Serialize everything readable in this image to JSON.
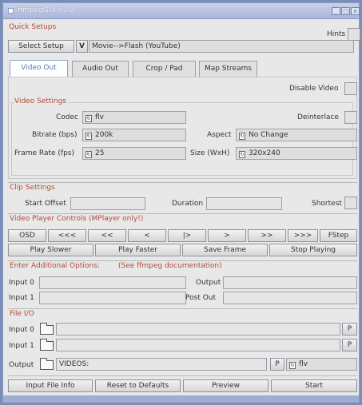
{
  "window": {
    "title": "ffmpegGUI v3.0",
    "controls": [
      "_",
      "□",
      "x"
    ]
  },
  "quick_setups": {
    "label": "Quick Setups",
    "hints_label": "Hints",
    "select_setup_button": "Select Setup",
    "v_button": "V",
    "current_setup": "Movie-->Flash (YouTube)"
  },
  "tabs": [
    "Video Out",
    "Audio Out",
    "Crop / Pad",
    "Map Streams"
  ],
  "video_out": {
    "disable_video_label": "Disable Video",
    "video_settings_label": "Video Settings",
    "codec_label": "Codec",
    "codec_value": "flv",
    "deinterlace_label": "Deinterlace",
    "bitrate_label": "Bitrate (bps)",
    "bitrate_value": "200k",
    "aspect_label": "Aspect",
    "aspect_value": "No Change",
    "framerate_label": "Frame Rate (fps)",
    "framerate_value": "25",
    "size_label": "Size (WxH)",
    "size_value": "320x240"
  },
  "clip_settings": {
    "label": "Clip Settings",
    "start_offset_label": "Start Offset",
    "duration_label": "Duration",
    "shortest_label": "Shortest"
  },
  "player_controls": {
    "label": "Video Player Controls (MPlayer only!)",
    "row1": [
      "OSD",
      "<<<",
      "<<",
      "<",
      "|>",
      ">",
      ">>",
      ">>>",
      "FStep"
    ],
    "row2": [
      "Play Slower",
      "Play Faster",
      "Save Frame",
      "Stop Playing"
    ]
  },
  "additional_options": {
    "label": "Enter Additional Options:",
    "doc_label": "(See ffmpeg documentation)",
    "input0_label": "Input 0",
    "input1_label": "Input 1",
    "output_label": "Output",
    "postout_label": "Post Out"
  },
  "file_io": {
    "label": "File I/O",
    "input0_label": "Input 0",
    "input1_label": "Input 1",
    "output_label": "Output",
    "output_value": "VIDEOS:",
    "p_label": "P",
    "ext_value": "flv"
  },
  "bottom_buttons": [
    "Input File Info",
    "Reset to Defaults",
    "Preview",
    "Start"
  ],
  "colors": {
    "section_label": "#b04a3a",
    "active_tab_text": "#5b78b5",
    "titlebar": "#a9b7da"
  }
}
